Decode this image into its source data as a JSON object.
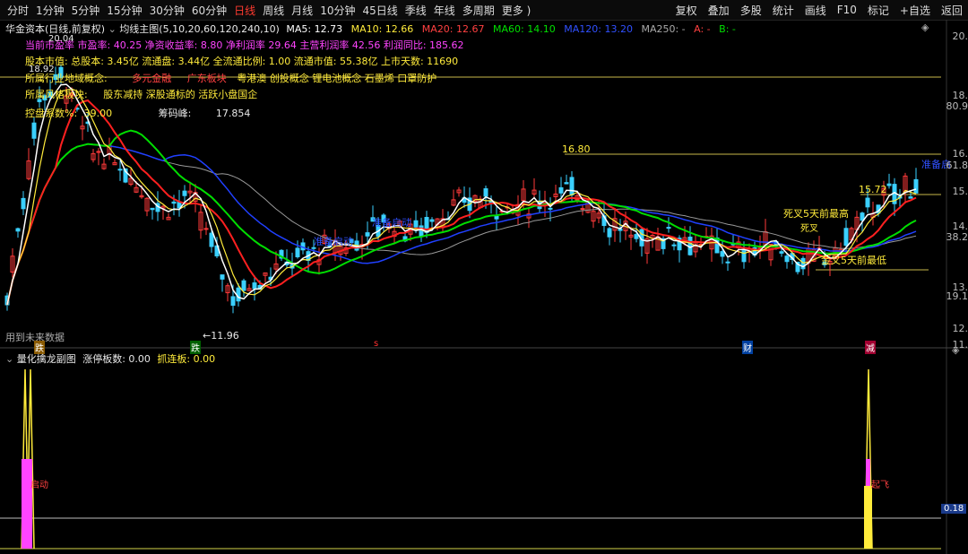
{
  "toolbar": {
    "periods": [
      "分时",
      "1分钟",
      "5分钟",
      "15分钟",
      "30分钟",
      "60分钟",
      "日线",
      "周线",
      "月线",
      "10分钟",
      "45日线",
      "季线",
      "年线",
      "多周期",
      "更多 )"
    ],
    "active_period": "日线",
    "tools": [
      "复权",
      "叠加",
      "多股",
      "统计",
      "画线",
      "F10",
      "标记",
      "+自选",
      "返回"
    ]
  },
  "main": {
    "stock_title": "华金资本(日线,前复权)",
    "indicator_name": "均线主图(5,10,20,60,120,240,10)",
    "ma5": "MA5: 12.73",
    "ma10": "MA10: 12.66",
    "ma20": "MA20: 12.67",
    "ma60": "MA60: 14.10",
    "ma120": "MA120: 13.20",
    "ma250": "MA250: -",
    "a_val": "A: -",
    "b_val": "B: -",
    "fin_line": "当前市盈率 市盈率: 40.25 净资收益率: 8.80 净利润率 29.64 主营利润率 42.56 利润同比: 185.62",
    "share_line": "股本市值: 总股本: 3.45亿 流通盘: 3.44亿 全流通比例: 1.00 流通市值: 55.38亿 上市天数: 11690",
    "industry_label": "所属行业地域概念:",
    "industry_a": "多元金融",
    "industry_b": "广东板块",
    "industry_rest": "粤港澳 创投概念 锂电池概念 石墨烯 口罩防护",
    "style_label": "所属风格板块:",
    "style_value": "股东减持 深股通标的 活跃小盘国企",
    "control_label": "控盘系数%:",
    "control_value": "39.00",
    "chip_label": "筹码峰:",
    "chip_value": "17.854",
    "price_high_label": "20.04",
    "price_2": "18.92",
    "price_1680": "16.80",
    "price_1572": "15.72",
    "price_low": "←11.96",
    "ann_sicha": "死叉5天前最高",
    "ann_sicha2": "死叉",
    "ann_jincha": "金叉5天前最低",
    "ann_zhunbei": "准备启动",
    "ann_zhunbei2": "准备启动",
    "ann_zhunbei3": "准备启",
    "future_note": "用到未来数据",
    "tag_1": "跌",
    "tag_2": "跌",
    "tag_3": "财",
    "tag_4": "减",
    "tag_5": "s",
    "yaxis": [
      "20.",
      "18.",
      "80.9",
      "16.",
      "61.8",
      "15.",
      "14.",
      "38.2",
      "13.",
      "19.1",
      "12.",
      "11."
    ]
  },
  "sub": {
    "title": "量化擒龙副图",
    "zt": "涨停板数: 0.00",
    "zl": "抓连板: 0.00",
    "tag_left": "启动",
    "tag_right": "起飞",
    "yaxis_val": "0.18"
  },
  "colors": {
    "ma5": "#ffffff",
    "ma10": "#ffeb3b",
    "ma20": "#ff2020",
    "ma60": "#00dd00",
    "ma120": "#2040ff",
    "ma250": "#999999"
  }
}
